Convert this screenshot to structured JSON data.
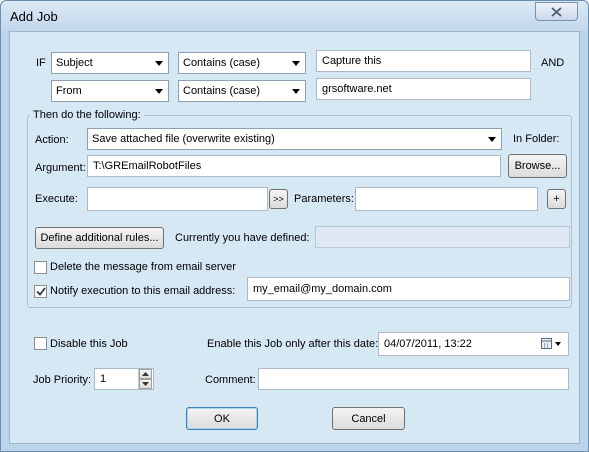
{
  "window": {
    "title": "Add Job",
    "close_icon": "close-icon"
  },
  "condition": {
    "if_label": "IF",
    "and_label": "AND",
    "row1": {
      "field": "Subject",
      "operator": "Contains (case)",
      "value": "Capture this"
    },
    "row2": {
      "field": "From",
      "operator": "Contains (case)",
      "value": "grsoftware.net"
    }
  },
  "actions": {
    "group_title": "Then do the following:",
    "action_label": "Action:",
    "action_value": "Save attached file (overwrite existing)",
    "in_folder_label": "In Folder:",
    "argument_label": "Argument:",
    "argument_value": "T:\\GREmailRobotFiles",
    "browse_label": "Browse...",
    "execute_label": "Execute:",
    "execute_value": "",
    "expand_label": ">>",
    "parameters_label": "Parameters:",
    "parameters_value": "",
    "plus_label": "+",
    "define_rules_label": "Define additional rules...",
    "defined_label": "Currently you have defined:",
    "defined_value": "",
    "delete_label": "Delete the message from email server",
    "delete_checked": false,
    "notify_label": "Notify execution to this email address:",
    "notify_checked": true,
    "notify_email": "my_email@my_domain.com"
  },
  "job": {
    "disable_label": "Disable this Job",
    "disable_checked": false,
    "enable_after_label": "Enable this Job only after this date:",
    "enable_after_value": "04/07/2011, 13:22",
    "priority_label": "Job Priority:",
    "priority_value": "1",
    "comment_label": "Comment:",
    "comment_value": ""
  },
  "buttons": {
    "ok": "OK",
    "cancel": "Cancel"
  },
  "colors": {
    "window_frame": "#bcd4ea",
    "client_bg": "#d7e8f5",
    "accent": "#6b8fb2"
  }
}
